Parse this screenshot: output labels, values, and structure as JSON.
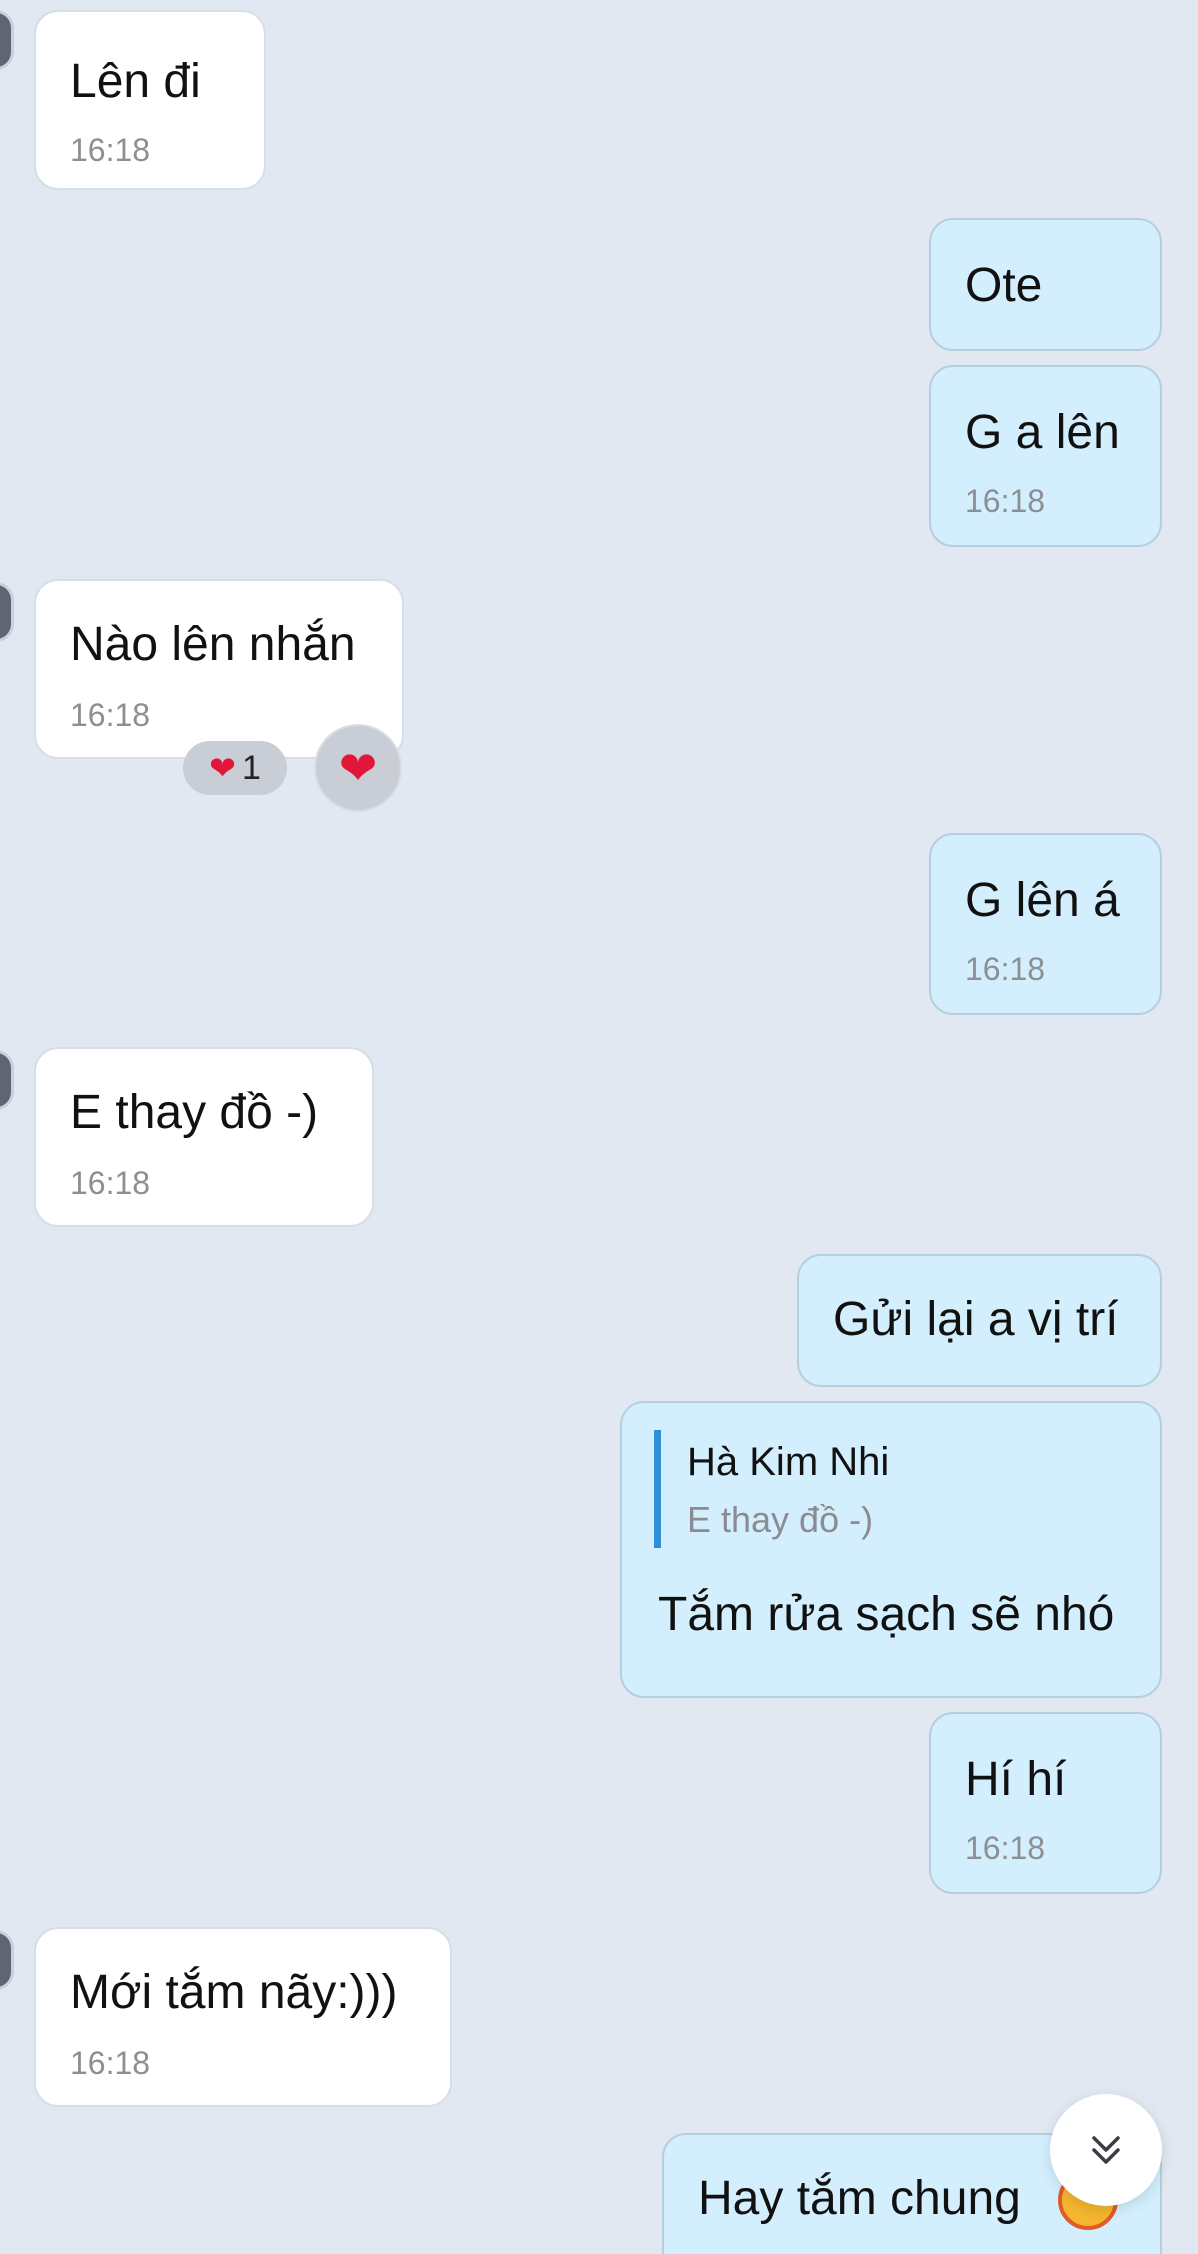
{
  "colors": {
    "background": "#e1e8f2",
    "incoming_bubble": "#ffffff",
    "outgoing_bubble": "#d3effd",
    "quote_bar": "#2f8fd8",
    "heart": "#e3163a"
  },
  "messages": [
    {
      "direction": "incoming",
      "text": "Lên đi",
      "time": "16:18"
    },
    {
      "direction": "outgoing",
      "text": "Ote"
    },
    {
      "direction": "outgoing",
      "text": "G a lên",
      "time": "16:18"
    },
    {
      "direction": "incoming",
      "text": "Nào lên nhắn",
      "time": "16:18",
      "reaction": {
        "icon": "heart-icon",
        "count": "1"
      }
    },
    {
      "direction": "outgoing",
      "text": "G lên á",
      "time": "16:18"
    },
    {
      "direction": "incoming",
      "text": "E thay đồ -)",
      "time": "16:18"
    },
    {
      "direction": "outgoing",
      "text": "Gửi lại a vị trí"
    },
    {
      "direction": "outgoing",
      "text": "Tắm rửa sạch sẽ nhó",
      "reply_to": {
        "author": "Hà Kim Nhi",
        "text": "E thay đồ -)"
      }
    },
    {
      "direction": "outgoing",
      "text": "Hí hí",
      "time": "16:18"
    },
    {
      "direction": "incoming",
      "text": "Mới tắm nãy:)))",
      "time": "16:18"
    },
    {
      "direction": "outgoing",
      "text": "Hay tắm chung",
      "emoji": "grinning-face-icon"
    }
  ],
  "scroll_button": {
    "icon": "double-chevron-down-icon"
  },
  "react_button": {
    "icon": "heart-icon"
  }
}
